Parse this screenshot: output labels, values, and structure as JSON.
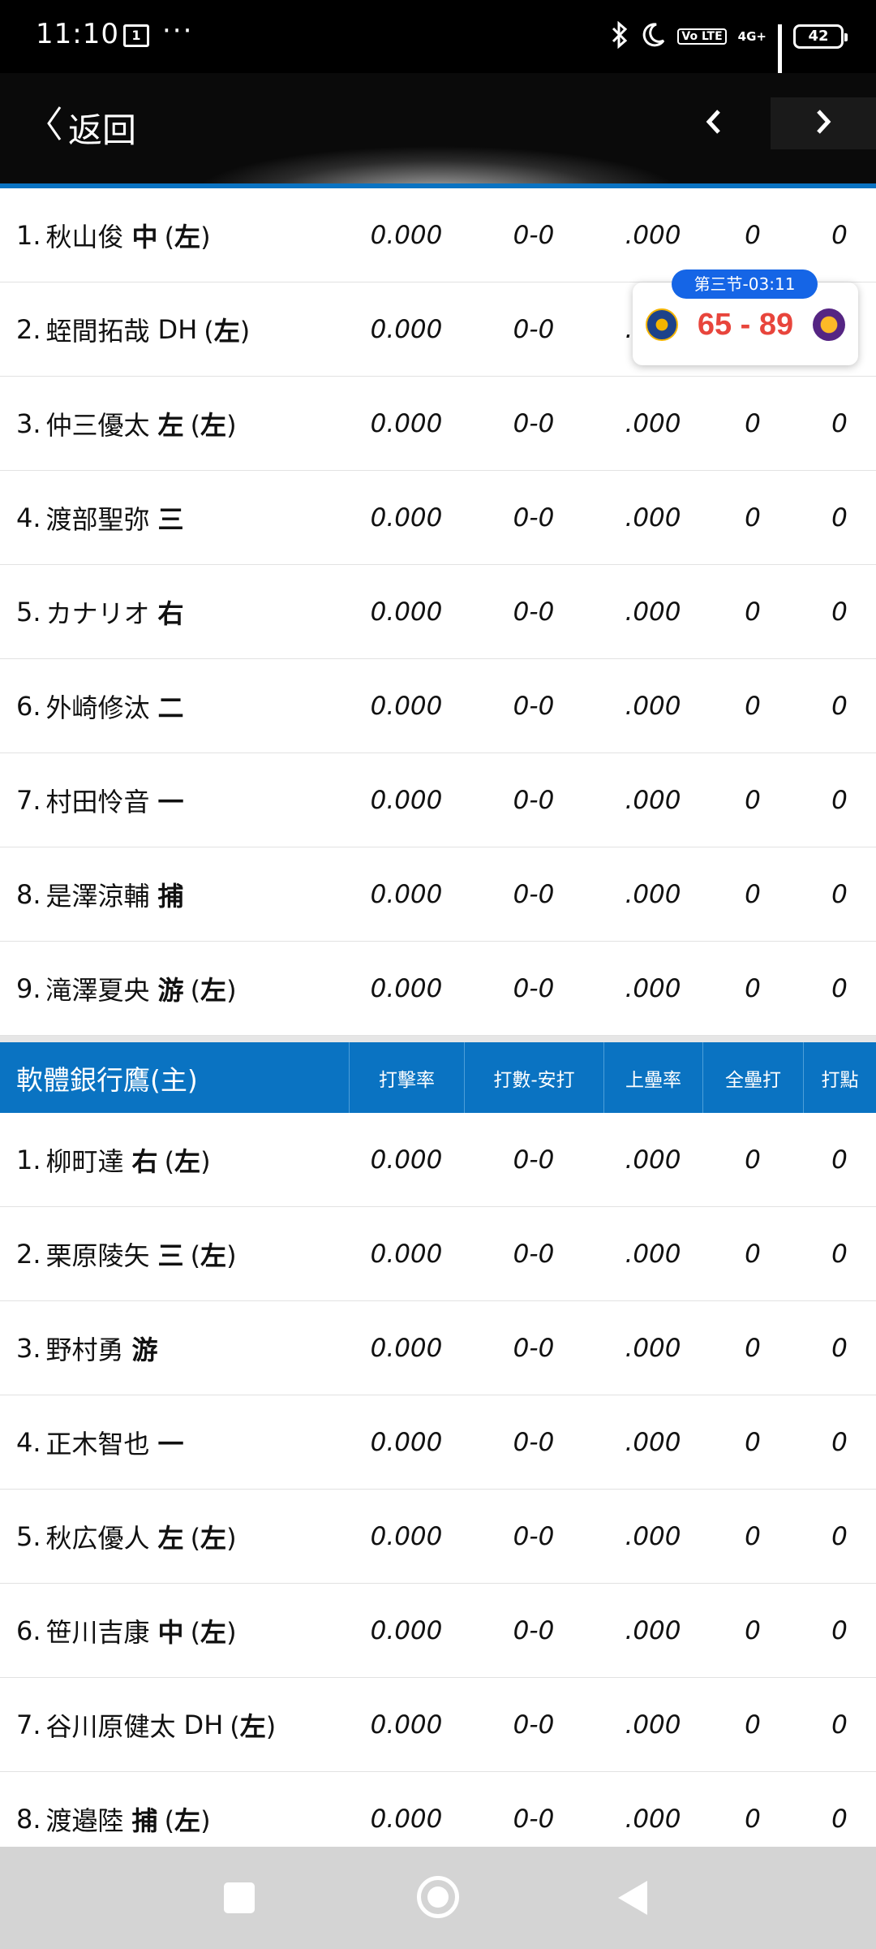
{
  "status_bar": {
    "time": "11:10",
    "sim": "1",
    "more": "···",
    "volte": "Vo LTE",
    "network": "4G+",
    "battery": "42"
  },
  "header": {
    "back_label": "返回",
    "prev_icon": "chevron-left-icon",
    "next_icon": "chevron-right-icon"
  },
  "score_widget": {
    "period": "第三节-03:11",
    "score": "65 - 89"
  },
  "away_rows": [
    {
      "num": "1.",
      "name": "秋山俊",
      "pos": "中",
      "hand": "左",
      "avg": "0.000",
      "ab_h": "0-0",
      "obp": ".000",
      "hr": "0",
      "rbi": "0"
    },
    {
      "num": "2.",
      "name": "蛭間拓哉",
      "pos": "DH",
      "hand": "左",
      "avg": "0.000",
      "ab_h": "0-0",
      "obp": ".000",
      "hr": "0",
      "rbi": "0"
    },
    {
      "num": "3.",
      "name": "仲三優太",
      "pos": "左",
      "hand": "左",
      "avg": "0.000",
      "ab_h": "0-0",
      "obp": ".000",
      "hr": "0",
      "rbi": "0"
    },
    {
      "num": "4.",
      "name": "渡部聖弥",
      "pos": "三",
      "hand": "",
      "avg": "0.000",
      "ab_h": "0-0",
      "obp": ".000",
      "hr": "0",
      "rbi": "0"
    },
    {
      "num": "5.",
      "name": "カナリオ",
      "pos": "右",
      "hand": "",
      "avg": "0.000",
      "ab_h": "0-0",
      "obp": ".000",
      "hr": "0",
      "rbi": "0"
    },
    {
      "num": "6.",
      "name": "外崎修汰",
      "pos": "二",
      "hand": "",
      "avg": "0.000",
      "ab_h": "0-0",
      "obp": ".000",
      "hr": "0",
      "rbi": "0"
    },
    {
      "num": "7.",
      "name": "村田怜音",
      "pos": "一",
      "hand": "",
      "avg": "0.000",
      "ab_h": "0-0",
      "obp": ".000",
      "hr": "0",
      "rbi": "0"
    },
    {
      "num": "8.",
      "name": "是澤涼輔",
      "pos": "捕",
      "hand": "",
      "avg": "0.000",
      "ab_h": "0-0",
      "obp": ".000",
      "hr": "0",
      "rbi": "0"
    },
    {
      "num": "9.",
      "name": "滝澤夏央",
      "pos": "游",
      "hand": "左",
      "avg": "0.000",
      "ab_h": "0-0",
      "obp": ".000",
      "hr": "0",
      "rbi": "0"
    }
  ],
  "home_team": {
    "name": "軟體銀行鷹(主)",
    "columns": [
      "打擊率",
      "打數-安打",
      "上壘率",
      "全壘打",
      "打點"
    ]
  },
  "home_rows": [
    {
      "num": "1.",
      "name": "柳町達",
      "pos": "右",
      "hand": "左",
      "avg": "0.000",
      "ab_h": "0-0",
      "obp": ".000",
      "hr": "0",
      "rbi": "0"
    },
    {
      "num": "2.",
      "name": "栗原陵矢",
      "pos": "三",
      "hand": "左",
      "avg": "0.000",
      "ab_h": "0-0",
      "obp": ".000",
      "hr": "0",
      "rbi": "0"
    },
    {
      "num": "3.",
      "name": "野村勇",
      "pos": "游",
      "hand": "",
      "avg": "0.000",
      "ab_h": "0-0",
      "obp": ".000",
      "hr": "0",
      "rbi": "0"
    },
    {
      "num": "4.",
      "name": "正木智也",
      "pos": "一",
      "hand": "",
      "avg": "0.000",
      "ab_h": "0-0",
      "obp": ".000",
      "hr": "0",
      "rbi": "0"
    },
    {
      "num": "5.",
      "name": "秋広優人",
      "pos": "左",
      "hand": "左",
      "avg": "0.000",
      "ab_h": "0-0",
      "obp": ".000",
      "hr": "0",
      "rbi": "0"
    },
    {
      "num": "6.",
      "name": "笹川吉康",
      "pos": "中",
      "hand": "左",
      "avg": "0.000",
      "ab_h": "0-0",
      "obp": ".000",
      "hr": "0",
      "rbi": "0"
    },
    {
      "num": "7.",
      "name": "谷川原健太",
      "pos": "DH",
      "hand": "左",
      "avg": "0.000",
      "ab_h": "0-0",
      "obp": ".000",
      "hr": "0",
      "rbi": "0"
    },
    {
      "num": "8.",
      "name": "渡邉陸",
      "pos": "捕",
      "hand": "左",
      "avg": "0.000",
      "ab_h": "0-0",
      "obp": ".000",
      "hr": "0",
      "rbi": "0"
    }
  ],
  "nav_bar": {
    "recents_icon": "square-icon",
    "home_icon": "circle-home-icon",
    "back_icon": "triangle-back-icon"
  }
}
